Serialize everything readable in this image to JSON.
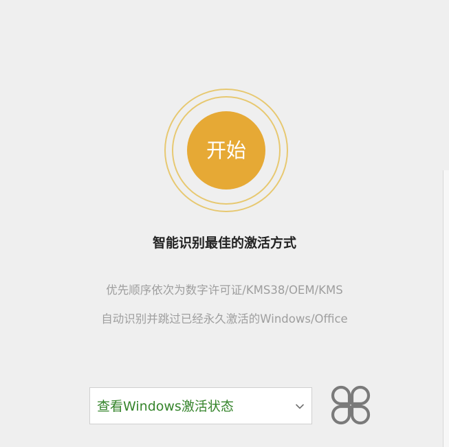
{
  "start": {
    "label": "开始"
  },
  "headline": "智能识别最佳的激活方式",
  "description": {
    "line1": "优先顺序依次为数字许可证/KMS38/OEM/KMS",
    "line2": "自动识别并跳过已经永久激活的Windows/Office"
  },
  "status_select": {
    "selected": "查看Windows激活状态",
    "icon": "chevron-down-icon"
  },
  "apps_button": {
    "icon": "apps-icon"
  },
  "colors": {
    "accent": "#e6a935",
    "ring": "#e7c870",
    "select_text": "#35842b",
    "description_text": "#9e9e9e",
    "headline_text": "#222222",
    "background": "#efefef"
  }
}
